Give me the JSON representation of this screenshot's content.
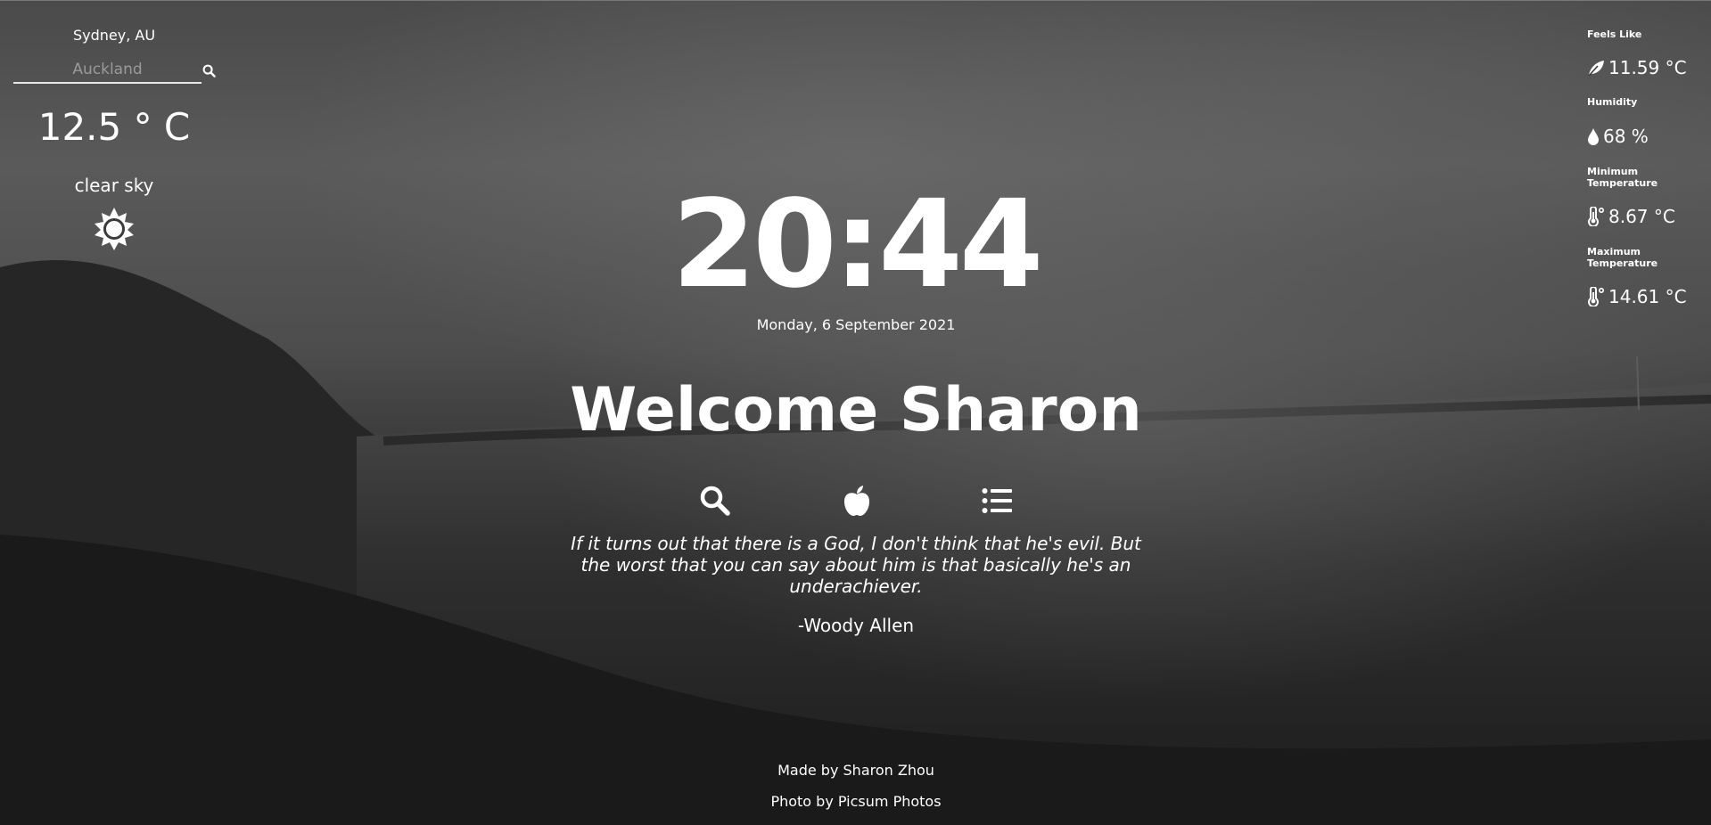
{
  "weather": {
    "location": "Sydney, AU",
    "search_placeholder": "Auckland",
    "temperature": "12.5 ° C",
    "description": "clear sky",
    "icon": "sun-icon"
  },
  "stats": {
    "feels_like": {
      "label": "Feels Like",
      "value": "11.59 °C",
      "icon": "leaf-icon"
    },
    "humidity": {
      "label": "Humidity",
      "value": "68 %",
      "icon": "water-drop-icon"
    },
    "min_temp": {
      "label": "Minimum Temperature",
      "value": "8.67 °C",
      "icon": "thermometer-icon"
    },
    "max_temp": {
      "label": "Maximum Temperature",
      "value": "14.61 °C",
      "icon": "thermometer-icon"
    }
  },
  "clock": {
    "time": "20:44",
    "date": "Monday, 6 September 2021"
  },
  "greeting": "Welcome Sharon",
  "quick_links": [
    "search-icon",
    "apple-icon",
    "list-icon"
  ],
  "quote": {
    "text": "If it turns out that there is a God, I don't think that he's evil. But the worst that you can say about him is that basically he's an underachiever.",
    "author": "-Woody Allen"
  },
  "footer": {
    "made_by": "Made by Sharon Zhou",
    "photo_by": "Photo by Picsum Photos"
  },
  "colors": {
    "text": "#ffffff",
    "input_underline": "#e8e8e8",
    "placeholder": "#9a9a9a"
  }
}
